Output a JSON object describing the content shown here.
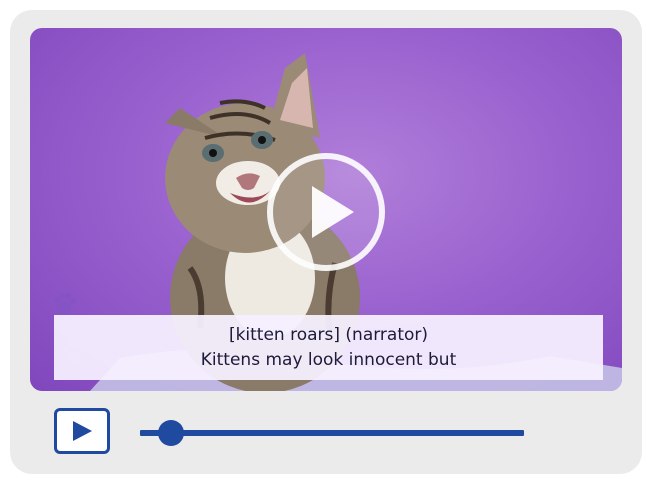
{
  "player": {
    "captions": {
      "line1": "[kitten roars] (narrator)",
      "line2": "Kittens may look innocent but"
    },
    "progress_fraction": 0.08,
    "colors": {
      "accent": "#1f4aa0",
      "background": "#ebebeb",
      "video_backdrop": "#9a62cf",
      "caption_bg": "#f6f0ff"
    },
    "icons": {
      "center": "play-circle-icon",
      "control": "play-icon",
      "decoration": "paw-prints-icon"
    }
  }
}
